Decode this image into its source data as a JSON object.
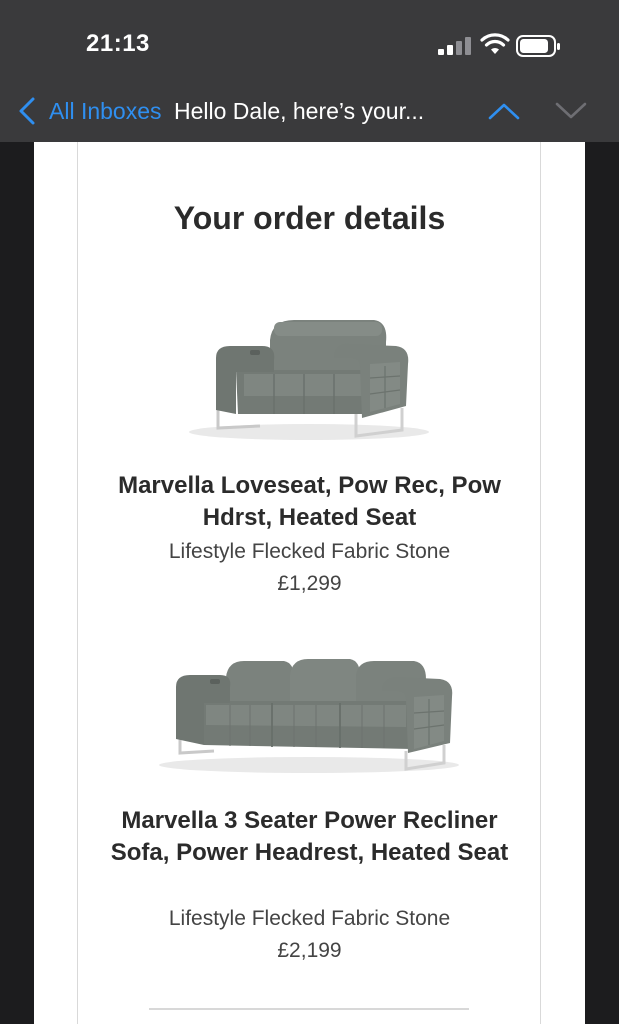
{
  "status_bar": {
    "time": "21:13"
  },
  "nav": {
    "back_label": "All Inboxes",
    "subject": "Hello Dale, here’s your..."
  },
  "email": {
    "heading": "Your order details",
    "products": [
      {
        "name": "Marvella Loveseat, Pow Rec, Pow Hdrst, Heated Seat",
        "variant": "Lifestyle Flecked Fabric Stone",
        "price": "£1,299"
      },
      {
        "name": "Marvella 3 Seater Power Recliner Sofa, Power Headrest, Heated Seat",
        "variant": "Lifestyle Flecked Fabric Stone",
        "price": "£2,199"
      }
    ]
  },
  "colors": {
    "accent": "#2f8ff0",
    "chrome": "#3a3a3c",
    "sofa_fabric": "#7d847f"
  },
  "icons": [
    "cellular-signal-icon",
    "wifi-icon",
    "battery-icon",
    "chevron-left-icon",
    "chevron-up-icon",
    "chevron-down-icon"
  ]
}
